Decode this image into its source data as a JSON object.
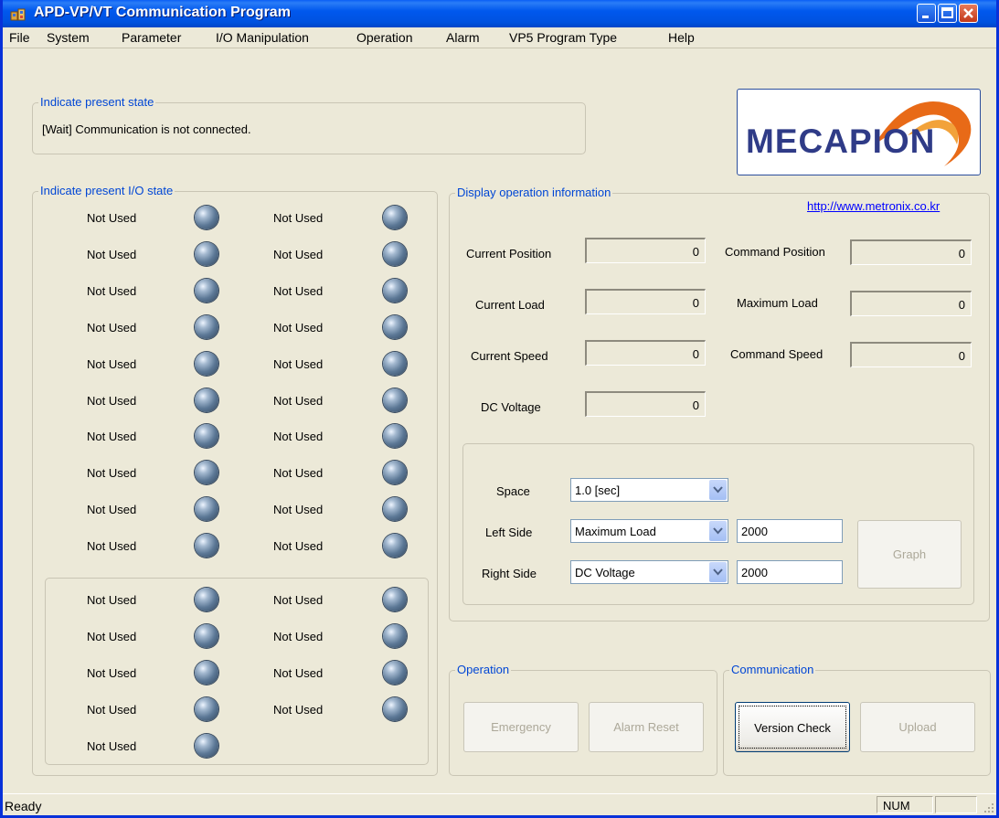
{
  "window": {
    "title": "APD-VP/VT Communication Program"
  },
  "menu": [
    "File",
    "System",
    "Parameter",
    "I/O Manipulation",
    "Operation",
    "Alarm",
    "VP5 Program Type",
    "Help"
  ],
  "present_state": {
    "title": "Indicate present state",
    "message": "[Wait] Communication is not connected."
  },
  "logo": {
    "text": "MECAPION"
  },
  "io_state": {
    "title": "Indicate present I/O state",
    "group1": [
      [
        "Not Used",
        "Not Used"
      ],
      [
        "Not Used",
        "Not Used"
      ],
      [
        "Not Used",
        "Not Used"
      ],
      [
        "Not Used",
        "Not Used"
      ],
      [
        "Not Used",
        "Not Used"
      ],
      [
        "Not Used",
        "Not Used"
      ],
      [
        "Not Used",
        "Not Used"
      ],
      [
        "Not Used",
        "Not Used"
      ],
      [
        "Not Used",
        "Not Used"
      ],
      [
        "Not Used",
        "Not Used"
      ]
    ],
    "group2": [
      [
        "Not Used",
        "Not Used"
      ],
      [
        "Not Used",
        "Not Used"
      ],
      [
        "Not Used",
        "Not Used"
      ],
      [
        "Not Used",
        "Not Used"
      ],
      [
        "Not Used"
      ]
    ]
  },
  "operation_info": {
    "title": "Display operation information",
    "link": "http://www.metronix.co.kr",
    "current_position": {
      "label": "Current Position",
      "value": "0"
    },
    "command_position": {
      "label": "Command Position",
      "value": "0"
    },
    "current_load": {
      "label": "Current Load",
      "value": "0"
    },
    "maximum_load": {
      "label": "Maximum Load",
      "value": "0"
    },
    "current_speed": {
      "label": "Current Speed",
      "value": "0"
    },
    "command_speed": {
      "label": "Command Speed",
      "value": "0"
    },
    "dc_voltage": {
      "label": "DC Voltage",
      "value": "0"
    }
  },
  "graph_settings": {
    "space": {
      "label": "Space",
      "selected": "1.0 [sec]"
    },
    "left_side": {
      "label": "Left Side",
      "selected": "Maximum Load",
      "value": "2000"
    },
    "right_side": {
      "label": "Right Side",
      "selected": "DC Voltage",
      "value": "2000"
    },
    "graph_button": "Graph"
  },
  "operation": {
    "title": "Operation",
    "emergency": "Emergency",
    "alarm_reset": "Alarm Reset"
  },
  "communication": {
    "title": "Communication",
    "version_check": "Version Check",
    "upload": "Upload"
  },
  "status": {
    "text": "Ready",
    "num": "NUM"
  }
}
